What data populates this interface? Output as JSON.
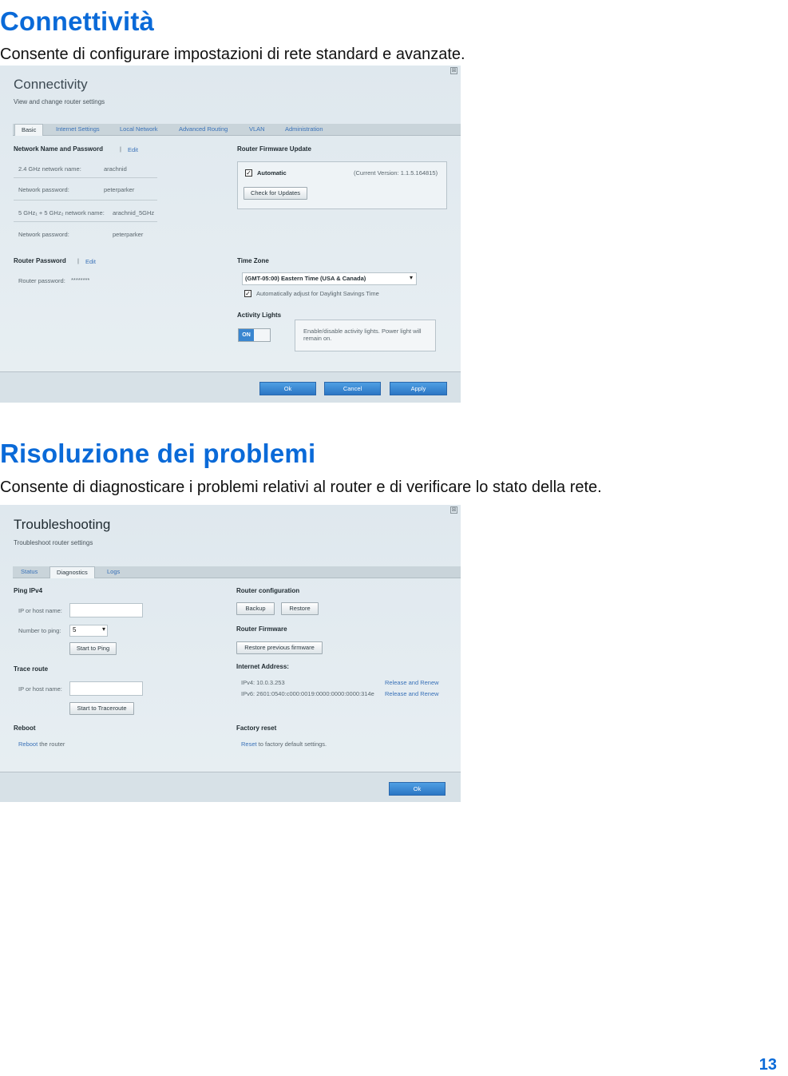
{
  "page": {
    "heading1": "Connettività",
    "lead1": "Consente di configurare impostazioni di rete standard e avanzate.",
    "heading2": "Risoluzione dei problemi",
    "lead2": "Consente di diagnosticare i problemi relativi al router e di verificare lo stato della rete.",
    "page_number": "13"
  },
  "connectivity": {
    "title": "Connectivity",
    "subtitle": "View and change router settings",
    "close_glyph": "⊠",
    "tabs": [
      "Basic",
      "Internet Settings",
      "Local Network",
      "Advanced Routing",
      "VLAN",
      "Administration"
    ],
    "network_section": "Network Name and Password",
    "edit_sep": "|",
    "edit": "Edit",
    "net24_label": "2.4 GHz network name:",
    "net24_value": "arachnid",
    "pw1_label": "Network password:",
    "pw1_value": "peterparker",
    "net5_label": "5 GHz₁ + 5 GHz₂ network name:",
    "net5_value": "arachnid_5GHz",
    "pw2_label": "Network password:",
    "pw2_value": "peterparker",
    "router_pw_section": "Router Password",
    "router_pw_label": "Router password:",
    "router_pw_value": "********",
    "firmware_section": "Router Firmware Update",
    "automatic": "Automatic",
    "current_version": "(Current Version: 1.1.5.164815)",
    "check_updates": "Check for Updates",
    "timezone_section": "Time Zone",
    "timezone_value": "(GMT-05:00) Eastern Time (USA & Canada)",
    "dst_label": "Automatically adjust for Daylight Savings Time",
    "activity_section": "Activity Lights",
    "toggle_on": "ON",
    "activity_note": "Enable/disable activity lights. Power light will remain on.",
    "ok": "Ok",
    "cancel": "Cancel",
    "apply": "Apply"
  },
  "troubleshooting": {
    "title": "Troubleshooting",
    "subtitle": "Troubleshoot router settings",
    "close_glyph": "⊠",
    "tabs": [
      "Status",
      "Diagnostics",
      "Logs"
    ],
    "ping_section": "Ping IPv4",
    "ping_host_label": "IP or host name:",
    "ping_number_label": "Number to ping:",
    "ping_number_value": "5",
    "start_ping": "Start to Ping",
    "trace_section": "Trace route",
    "trace_host_label": "IP or host name:",
    "start_trace": "Start to Traceroute",
    "reboot_section": "Reboot",
    "reboot_link": "Reboot",
    "reboot_rest": " the router",
    "config_section": "Router configuration",
    "backup": "Backup",
    "restore": "Restore",
    "firmware_section": "Router Firmware",
    "restore_fw": "Restore previous firmware",
    "internet_section": "Internet Address:",
    "ipv4": "IPv4: 10.0.3.253",
    "ipv6": "IPv6: 2601:0540:c000:0019:0000:0000:0000:314e",
    "release1": "Release and Renew",
    "release2": "Release and Renew",
    "factory_section": "Factory reset",
    "reset_link": "Reset",
    "reset_rest": " to factory default settings.",
    "ok": "Ok"
  }
}
